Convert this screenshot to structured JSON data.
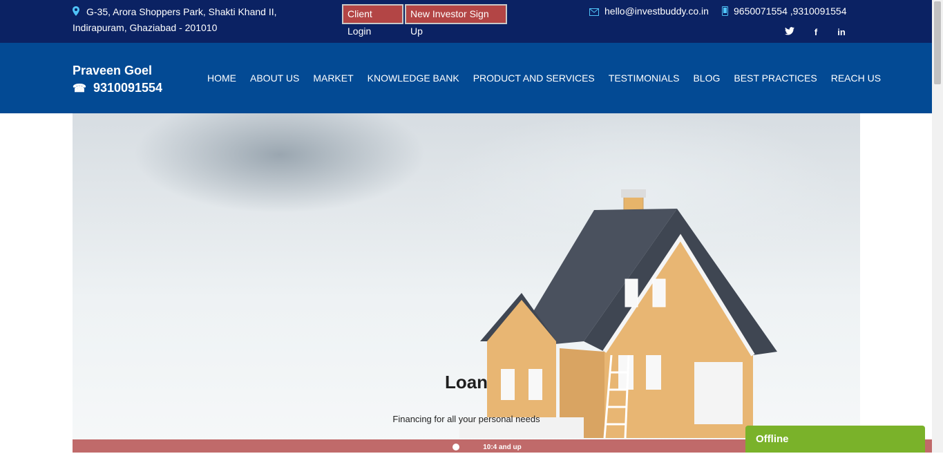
{
  "topbar": {
    "address_line1": "G-35, Arora Shoppers Park, Shakti Khand II,",
    "address_line2": "Indirapuram, Ghaziabad - 201010",
    "client_login": "Client Login",
    "new_investor_signup": "New Investor Sign Up",
    "email": "hello@investbuddy.co.in",
    "phones": "9650071554 ,9310091554",
    "social": [
      {
        "icon": "twitter-icon",
        "glyph": "🐦"
      },
      {
        "icon": "facebook-icon",
        "glyph": "f"
      },
      {
        "icon": "linkedin-icon",
        "glyph": "in"
      }
    ]
  },
  "brand": {
    "name": "Praveen Goel",
    "phone": "9310091554"
  },
  "nav": {
    "items": [
      {
        "label": "HOME"
      },
      {
        "label": "ABOUT US"
      },
      {
        "label": "MARKET"
      },
      {
        "label": "KNOWLEDGE BANK"
      },
      {
        "label": "PRODUCT AND SERVICES"
      },
      {
        "label": "TESTIMONIALS"
      },
      {
        "label": "BLOG"
      },
      {
        "label": "BEST PRACTICES"
      },
      {
        "label": "REACH US"
      }
    ]
  },
  "hero": {
    "title": "Loan",
    "subtitle": "Financing for all your personal needs"
  },
  "banner": {
    "text": "10:4 and up"
  },
  "chat": {
    "status": "Offline"
  },
  "colors": {
    "topbar": "#0b2263",
    "navbar": "#034a94",
    "button": "#b34545",
    "chat": "#7ab22a"
  }
}
